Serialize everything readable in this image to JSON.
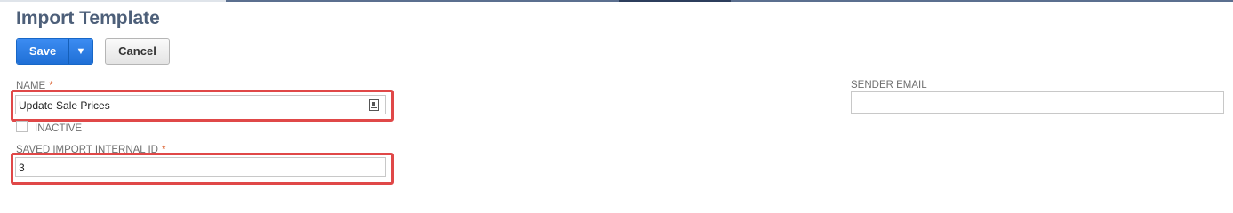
{
  "page": {
    "title": "Import Template"
  },
  "toolbar": {
    "save_label": "Save",
    "save_menu_arrow": "▼",
    "cancel_label": "Cancel"
  },
  "fields": {
    "name": {
      "label": "NAME",
      "required_mark": "*",
      "value": "Update Sale Prices",
      "icon": "field-help-icon"
    },
    "inactive": {
      "label": "INACTIVE",
      "checked": false
    },
    "saved_import_internal_id": {
      "label": "SAVED IMPORT INTERNAL ID",
      "required_mark": "*",
      "value": "3"
    },
    "sender_email": {
      "label": "SENDER EMAIL",
      "value": ""
    }
  },
  "colors": {
    "accent": "#1f6fd6",
    "title": "#4d5f79",
    "highlight": "#e04848",
    "required": "#d9541e"
  }
}
